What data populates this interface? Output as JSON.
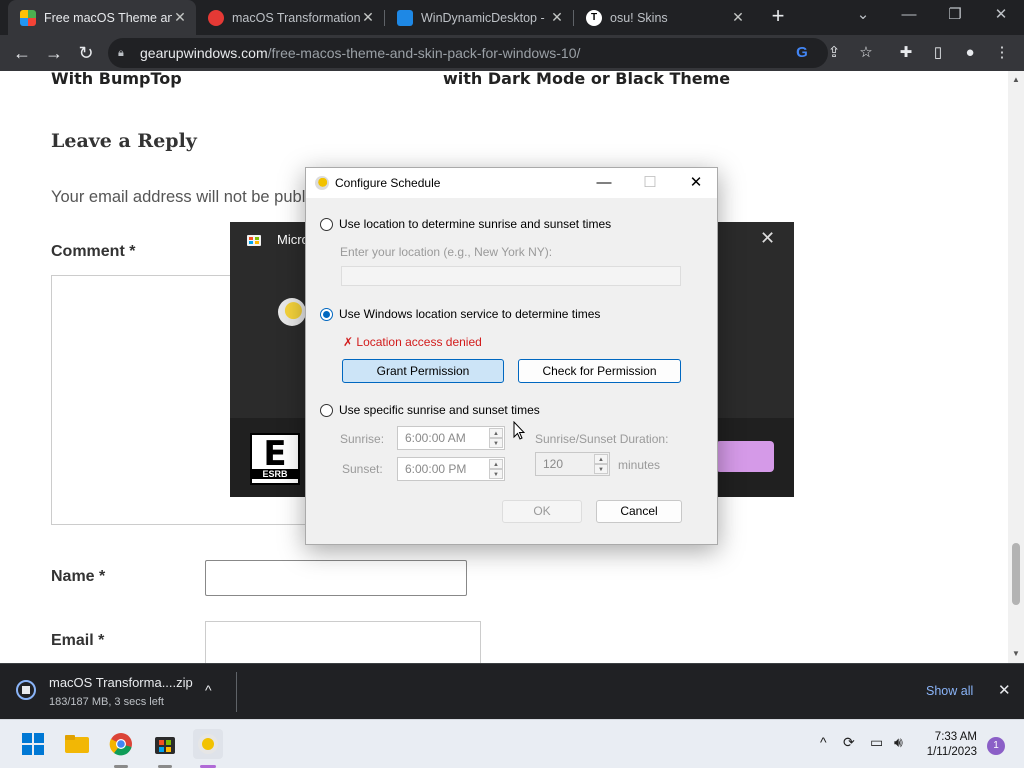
{
  "browser": {
    "tabs": [
      {
        "title": "Free macOS Theme and",
        "favicon": "leaf-icon"
      },
      {
        "title": "macOS Transformation",
        "favicon": "red-circle-icon"
      },
      {
        "title": "WinDynamicDesktop -",
        "favicon": "windows-icon"
      },
      {
        "title": "osu! Skins",
        "favicon": "t-icon"
      }
    ],
    "url_domain": "gearupwindows.com",
    "url_path": "/free-macos-theme-and-skin-pack-for-windows-10/"
  },
  "page": {
    "related_left": "With BumpTop",
    "related_right": "with Dark Mode or Black Theme",
    "reply_heading": "Leave a Reply",
    "email_notice": "Your email address will not be publis",
    "comment_label": "Comment *",
    "name_label": "Name *",
    "email_label": "Email *"
  },
  "store_dialog": {
    "title": "Micro",
    "rating": {
      "letter": "E",
      "text": "ESRB"
    }
  },
  "schedule_dialog": {
    "title": "Configure Schedule",
    "option_location": "Use location to determine sunrise and sunset times",
    "location_placeholder": "Enter your location (e.g., New York NY):",
    "option_windows": "Use Windows location service to determine times",
    "denied_message": "✗ Location access denied",
    "grant_button": "Grant Permission",
    "check_button": "Check for Permission",
    "option_specific": "Use specific sunrise and sunset times",
    "sunrise_label": "Sunrise:",
    "sunrise_value": "6:00:00 AM",
    "sunset_label": "Sunset:",
    "sunset_value": "6:00:00 PM",
    "duration_label": "Sunrise/Sunset Duration:",
    "duration_value": "120",
    "duration_unit": "minutes",
    "ok_button": "OK",
    "cancel_button": "Cancel",
    "selected_option": "windows"
  },
  "download": {
    "filename": "macOS Transforma....zip",
    "status": "183/187 MB, 3 secs left",
    "show_all": "Show all"
  },
  "taskbar": {
    "time": "7:33 AM",
    "date": "1/11/2023",
    "notification_count": "1"
  },
  "colors": {
    "accent": "#0067c0",
    "error": "#d21c1c",
    "link": "#8ab4f8"
  }
}
